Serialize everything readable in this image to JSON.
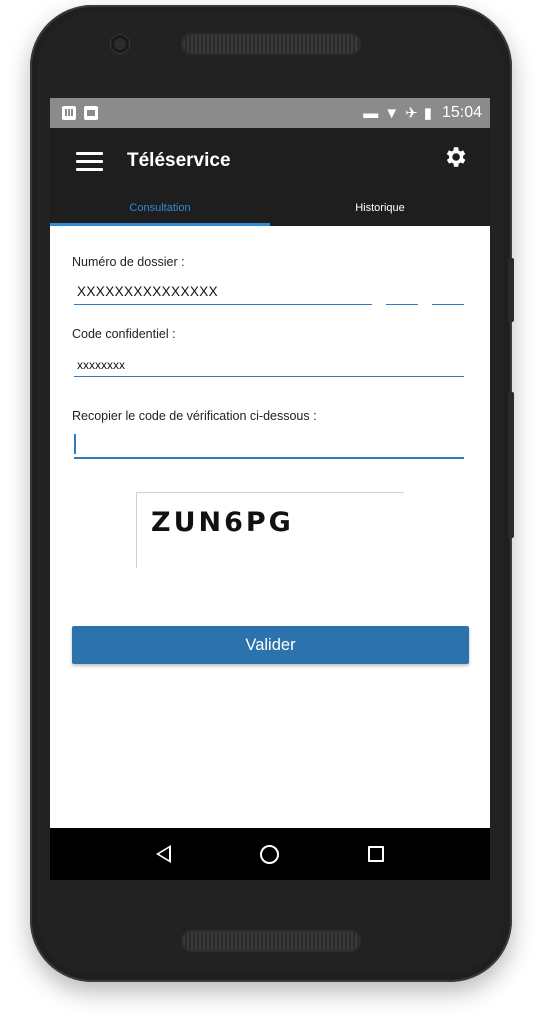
{
  "status_bar": {
    "time": "15:04",
    "icons": [
      "card-icon",
      "image-icon",
      "do-not-disturb-icon",
      "wifi-icon",
      "airplane-icon",
      "battery-icon"
    ]
  },
  "app_bar": {
    "title": "Téléservice",
    "menu_icon": "menu-icon",
    "settings_icon": "gear-icon"
  },
  "tabs": [
    {
      "label": "Consultation",
      "active": true
    },
    {
      "label": "Historique",
      "active": false
    }
  ],
  "form": {
    "dossier_label": "Numéro de dossier :",
    "dossier_value": "XXXXXXXXXXXXXXX",
    "dossier_suffix1_value": "",
    "dossier_suffix2_value": "",
    "code_label": "Code confidentiel :",
    "code_value": "xxxxxxxx",
    "captcha_label": "Recopier le code de vérification ci-dessous :",
    "captcha_input_value": "",
    "captcha_image_text": "ZUN6PG",
    "submit_label": "Valider"
  },
  "colors": {
    "accent": "#2f8bd6",
    "button": "#2c73ad",
    "appbar": "#1e1e1e",
    "statusbar": "#8b8b8b"
  },
  "nav_bar": {
    "icons": [
      "back-icon",
      "home-icon",
      "recents-icon"
    ]
  }
}
